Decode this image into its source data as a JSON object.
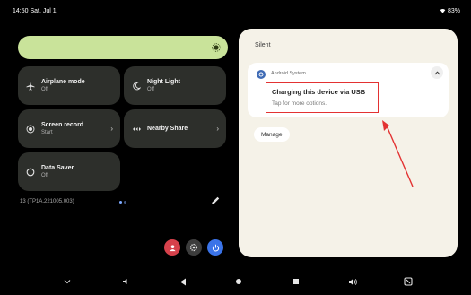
{
  "status_bar": {
    "time_date": "14:50  Sat, Jul 1",
    "battery": "83%"
  },
  "quick_settings": {
    "brightness_level": 0.96,
    "tiles": [
      {
        "label": "Airplane mode",
        "state": "Off",
        "icon": "airplane-icon"
      },
      {
        "label": "Night Light",
        "state": "Off",
        "icon": "moon-icon"
      },
      {
        "label": "Screen record",
        "state": "Start",
        "icon": "record-icon"
      },
      {
        "label": "Nearby Share",
        "state": "",
        "icon": "nearby-share-icon"
      },
      {
        "label": "Data Saver",
        "state": "Off",
        "icon": "data-saver-icon"
      }
    ],
    "build_number": "13 (TP1A.221005.003)",
    "colors": {
      "tile_bg": "#2d2f2b",
      "brightness": "#c9e39a",
      "accent_blue": "#3a73e8",
      "accent_red": "#d6414b"
    }
  },
  "notifications": {
    "section_label": "Silent",
    "card": {
      "app_name": "Android System",
      "title": "Charging this device via USB",
      "subtitle": "Tap for more options."
    },
    "manage_label": "Manage",
    "annotation_color": "#e33232"
  }
}
